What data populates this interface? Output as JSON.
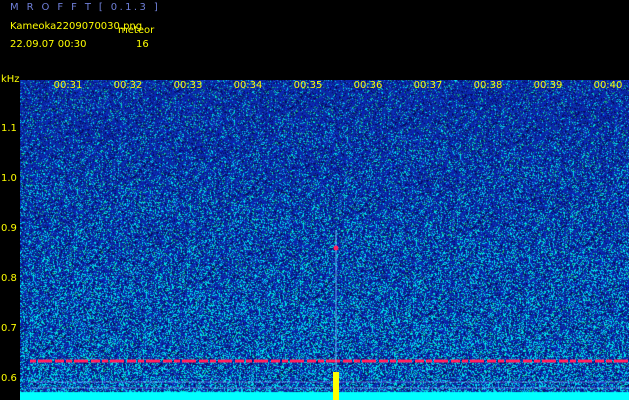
{
  "header": {
    "app_title": "M R O F F T  [ 0.1.3 ]",
    "filename": "Kameoka2209070030.png",
    "meteor_label": "meteor",
    "datetime": "22.09.07 00:30",
    "meteor_count": "16"
  },
  "axis": {
    "unit": "kHz",
    "y_labels": [
      {
        "text": "1.1",
        "value": 1.1
      },
      {
        "text": "1.0",
        "value": 1.0
      },
      {
        "text": "0.9",
        "value": 0.9
      },
      {
        "text": "0.8",
        "value": 0.8
      },
      {
        "text": "0.7",
        "value": 0.7
      },
      {
        "text": "0.6",
        "value": 0.6
      }
    ],
    "x_labels": [
      "00:31",
      "00:32",
      "00:33",
      "00:34",
      "00:35",
      "00:36",
      "00:37",
      "00:38",
      "00:39",
      "00:40"
    ]
  },
  "colors": {
    "label": "#ffff00",
    "title": "#6f7fd8",
    "background": "#0a1aa0",
    "noise_high": "#00ffff",
    "noise_mid": "#00c878",
    "carrier": "#ff2060",
    "signal_marker": "#ffff00"
  }
}
